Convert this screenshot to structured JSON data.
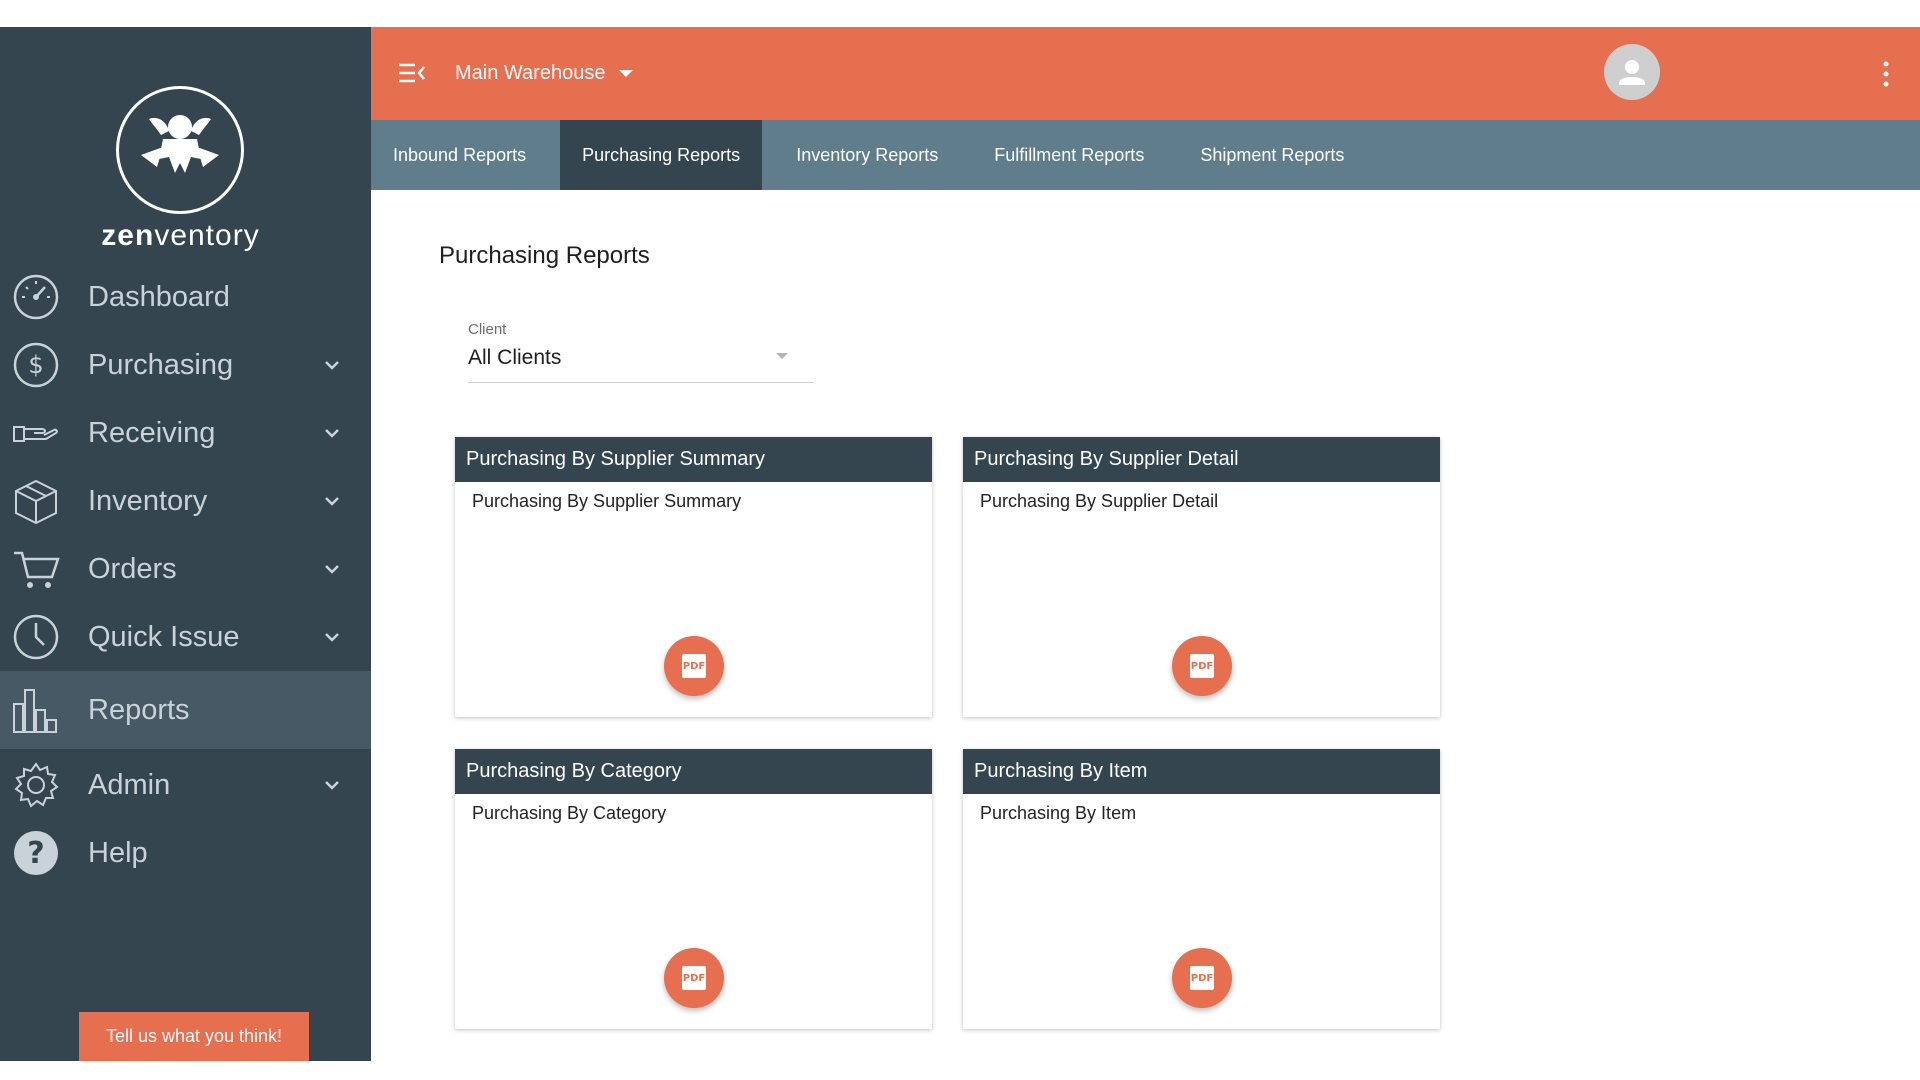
{
  "sidebar": {
    "logo_text_bold": "zen",
    "logo_text_rest": "ventory",
    "items": [
      {
        "label": "Dashboard",
        "icon": "dashboard-icon",
        "has_chevron": false,
        "active": false
      },
      {
        "label": "Purchasing",
        "icon": "dollar-icon",
        "has_chevron": true,
        "active": false
      },
      {
        "label": "Receiving",
        "icon": "hand-icon",
        "has_chevron": true,
        "active": false
      },
      {
        "label": "Inventory",
        "icon": "box-icon",
        "has_chevron": true,
        "active": false
      },
      {
        "label": "Orders",
        "icon": "cart-icon",
        "has_chevron": true,
        "active": false
      },
      {
        "label": "Quick Issue",
        "icon": "clock-icon",
        "has_chevron": true,
        "active": false
      },
      {
        "label": "Reports",
        "icon": "bar-chart-icon",
        "has_chevron": false,
        "active": true
      },
      {
        "label": "Admin",
        "icon": "gear-icon",
        "has_chevron": true,
        "active": false
      },
      {
        "label": "Help",
        "icon": "help-icon",
        "has_chevron": false,
        "active": false
      }
    ],
    "feedback_label": "Tell us what you think!"
  },
  "topbar": {
    "warehouse": "Main Warehouse"
  },
  "tabs": [
    {
      "label": "Inbound Reports",
      "active": false
    },
    {
      "label": "Purchasing Reports",
      "active": true
    },
    {
      "label": "Inventory Reports",
      "active": false
    },
    {
      "label": "Fulfillment Reports",
      "active": false
    },
    {
      "label": "Shipment Reports",
      "active": false
    }
  ],
  "main": {
    "title": "Purchasing Reports",
    "client": {
      "label": "Client",
      "value": "All Clients"
    },
    "cards": [
      {
        "title": "Purchasing By Supplier Summary",
        "description": "Purchasing By Supplier Summary",
        "button": "PDF"
      },
      {
        "title": "Purchasing By Supplier Detail",
        "description": "Purchasing By Supplier Detail",
        "button": "PDF"
      },
      {
        "title": "Purchasing By Category",
        "description": "Purchasing By Category",
        "button": "PDF"
      },
      {
        "title": "Purchasing By Item",
        "description": "Purchasing By Item",
        "button": "PDF"
      }
    ]
  },
  "colors": {
    "accent": "#e66f50",
    "sidebar": "#34454f",
    "tabbar": "#607d8b",
    "active_nav": "#465965"
  }
}
